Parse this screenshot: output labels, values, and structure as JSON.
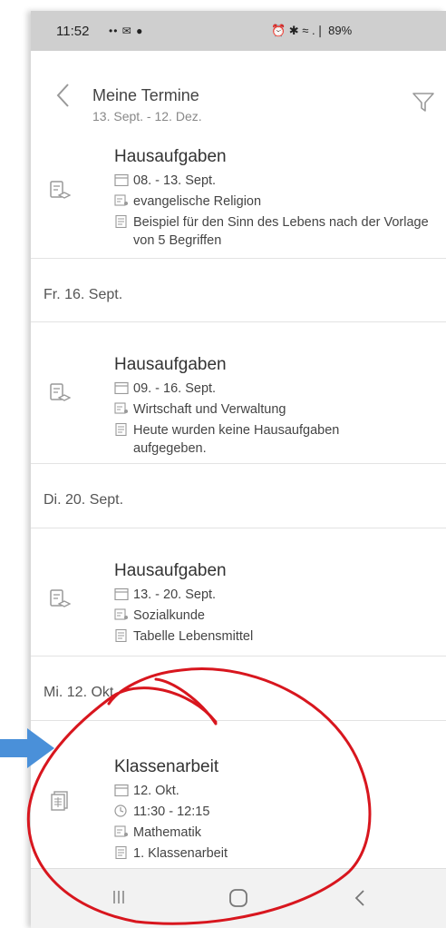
{
  "status_bar": {
    "time": "11:52",
    "left_icons": "•• ✉ ●",
    "right_text": "⏰ ✱ ≈ .❘ 89%"
  },
  "header": {
    "title": "Meine Termine",
    "subtitle": "13. Sept. - 12. Dez."
  },
  "groups": [
    {
      "date": "",
      "entries": [
        {
          "type": "Hausaufgaben",
          "date_range": "08. - 13. Sept.",
          "subject": "evangelische Religion",
          "note": "Beispiel für den Sinn des Lebens nach der Vorlage von 5 Begriffen"
        }
      ]
    },
    {
      "date": "Fr. 16. Sept.",
      "entries": [
        {
          "type": "Hausaufgaben",
          "date_range": "09. - 16. Sept.",
          "subject": "Wirtschaft und Verwaltung",
          "note": "Heute wurden keine Hausaufgaben aufgegeben."
        }
      ]
    },
    {
      "date": "Di. 20. Sept.",
      "entries": [
        {
          "type": "Hausaufgaben",
          "date_range": "13. - 20. Sept.",
          "subject": "Sozialkunde",
          "note": "Tabelle Lebensmittel"
        }
      ]
    },
    {
      "date": "Mi. 12. Okt.",
      "entries": [
        {
          "type": "Klassenarbeit",
          "date_range": "12. Okt.",
          "time": "11:30 - 12:15",
          "subject": "Mathematik",
          "note": "1. Klassenarbeit"
        }
      ]
    }
  ],
  "colors": {
    "annotation_red": "#d8161e",
    "annotation_blue": "#4a90d9",
    "status_bar_bg": "#cfcfcf"
  }
}
